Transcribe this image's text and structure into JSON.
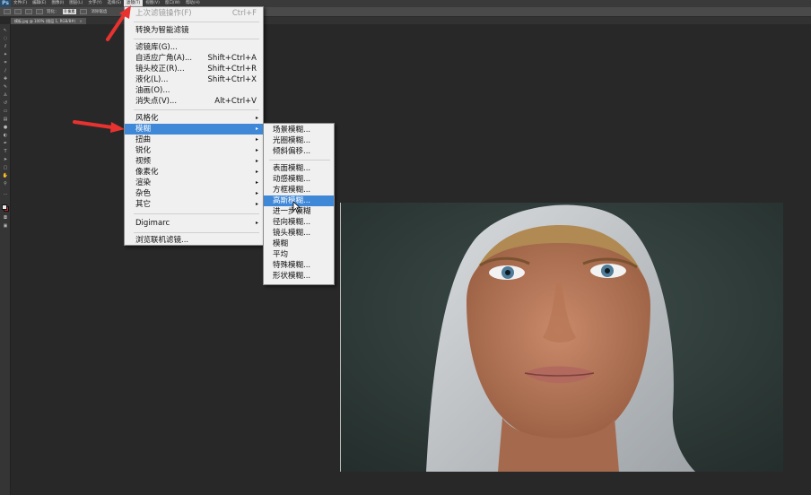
{
  "app": {
    "logo": "Ps",
    "menus": [
      "文件(F)",
      "编辑(E)",
      "图像(I)",
      "图层(L)",
      "文字(Y)",
      "选择(S)",
      "滤镜(T)",
      "视图(V)",
      "窗口(W)",
      "帮助(H)"
    ],
    "active_menu_index": 6
  },
  "options_bar": {
    "feather_label": "羽化：",
    "feather_value": "0 像素",
    "antialias_label": "消除锯齿"
  },
  "document_tab": {
    "title": "模板.jpg @ 100% (图层 1, RGB/8#)",
    "close_glyph": "×"
  },
  "filter_menu": {
    "items": [
      {
        "label": "上次滤镜操作(F)",
        "shortcut": "Ctrl+F",
        "disabled": true
      },
      {
        "label": "转换为智能滤镜"
      },
      {
        "label": "滤镜库(G)..."
      },
      {
        "label": "自适应广角(A)...",
        "shortcut": "Shift+Ctrl+A"
      },
      {
        "label": "镜头校正(R)...",
        "shortcut": "Shift+Ctrl+R"
      },
      {
        "label": "液化(L)...",
        "shortcut": "Shift+Ctrl+X"
      },
      {
        "label": "油画(O)..."
      },
      {
        "label": "消失点(V)...",
        "shortcut": "Alt+Ctrl+V"
      },
      {
        "label": "风格化",
        "has_submenu": true
      },
      {
        "label": "模糊",
        "has_submenu": true,
        "highlighted": true
      },
      {
        "label": "扭曲",
        "has_submenu": true
      },
      {
        "label": "锐化",
        "has_submenu": true
      },
      {
        "label": "视频",
        "has_submenu": true
      },
      {
        "label": "像素化",
        "has_submenu": true
      },
      {
        "label": "渲染",
        "has_submenu": true
      },
      {
        "label": "杂色",
        "has_submenu": true
      },
      {
        "label": "其它",
        "has_submenu": true
      },
      {
        "label": "Digimarc",
        "has_submenu": true
      },
      {
        "label": "浏览联机滤镜..."
      }
    ]
  },
  "blur_submenu": {
    "items": [
      {
        "label": "场景模糊..."
      },
      {
        "label": "光圈模糊..."
      },
      {
        "label": "倾斜偏移..."
      },
      {
        "label": "表面模糊..."
      },
      {
        "label": "动感模糊..."
      },
      {
        "label": "方框模糊..."
      },
      {
        "label": "高斯模糊...",
        "highlighted": true
      },
      {
        "label": "进一步模糊"
      },
      {
        "label": "径向模糊..."
      },
      {
        "label": "镜头模糊..."
      },
      {
        "label": "模糊"
      },
      {
        "label": "平均"
      },
      {
        "label": "特殊模糊..."
      },
      {
        "label": "形状模糊..."
      }
    ]
  },
  "icons": {
    "arrow_right": "▸",
    "annotation_color": "#e8322f",
    "highlight_color": "#3f88d8"
  }
}
